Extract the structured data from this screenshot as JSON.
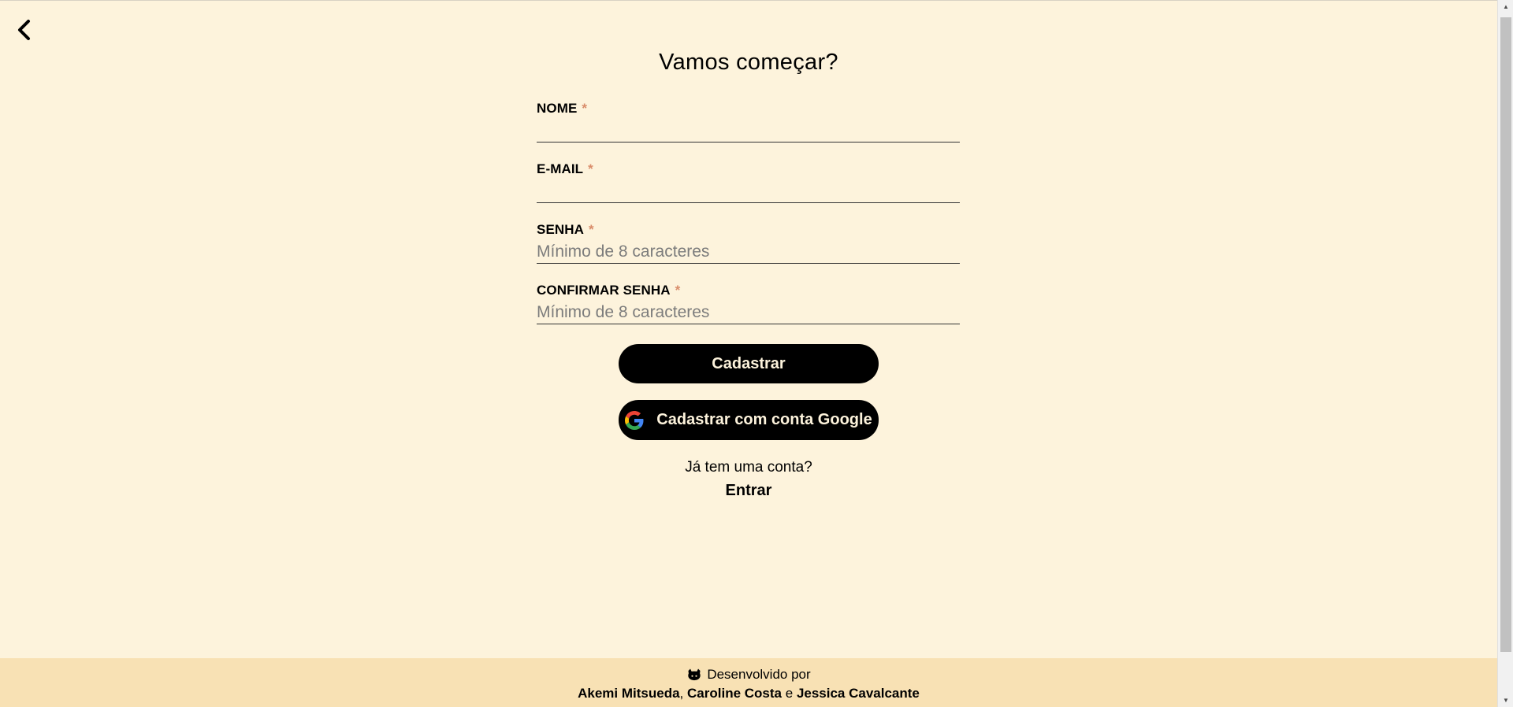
{
  "header": {
    "title": "Vamos começar?"
  },
  "icons": {
    "back": "chevron-left-icon",
    "google": "google-icon",
    "github": "github-icon"
  },
  "form": {
    "fields": [
      {
        "label": "NOME",
        "required_mark": "*",
        "placeholder": "",
        "value": ""
      },
      {
        "label": "E-MAIL",
        "required_mark": "*",
        "placeholder": "",
        "value": ""
      },
      {
        "label": "SENHA",
        "required_mark": "*",
        "placeholder": "Mínimo de 8 caracteres",
        "value": ""
      },
      {
        "label": "CONFIRMAR SENHA",
        "required_mark": "*",
        "placeholder": "Mínimo de 8 caracteres",
        "value": ""
      }
    ],
    "register_label": "Cadastrar",
    "google_label": "Cadastrar com conta Google"
  },
  "login": {
    "question": "Já tem uma conta?",
    "link_label": "Entrar"
  },
  "footer": {
    "developed_by": "Desenvolvido por",
    "authors": [
      "Akemi Mitsueda",
      "Caroline Costa",
      "Jessica Cavalcante"
    ],
    "separator": ",",
    "conjunction": "e"
  },
  "colors": {
    "background": "#fdf3dc",
    "footer_background": "#f8e1b4",
    "button_background": "#000000",
    "button_text": "#fdf3dc",
    "required_mark": "#d98c6a"
  }
}
